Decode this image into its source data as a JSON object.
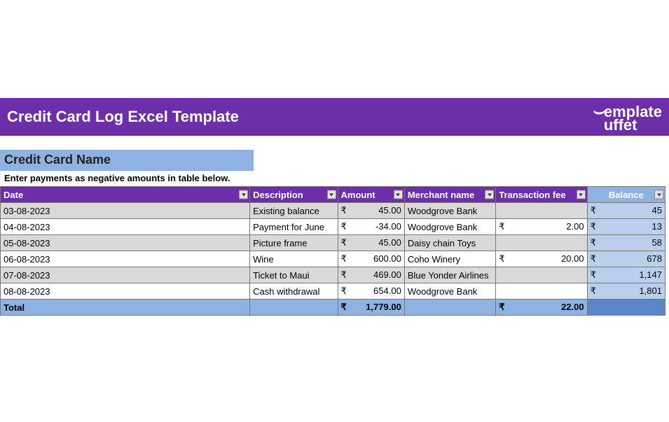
{
  "title": "Credit Card Log Excel Template",
  "logo_text_1": "emplate",
  "logo_text_2": "uffet",
  "card_name_label": "Credit Card Name",
  "instruction": "Enter payments as negative amounts in table below.",
  "currency_symbol": "₹",
  "columns": {
    "date": "Date",
    "description": "Description",
    "amount": "Amount",
    "merchant": "Merchant name",
    "fee": "Transaction fee",
    "balance": "Balance"
  },
  "rows": [
    {
      "date": "03-08-2023",
      "description": "Existing balance",
      "amount": "45.00",
      "merchant": "Woodgrove Bank",
      "fee": "",
      "balance": "45"
    },
    {
      "date": "04-08-2023",
      "description": "Payment for June",
      "amount": "-34.00",
      "merchant": "Woodgrove Bank",
      "fee": "2.00",
      "balance": "13"
    },
    {
      "date": "05-08-2023",
      "description": "Picture frame",
      "amount": "45.00",
      "merchant": "Daisy chain Toys",
      "fee": "",
      "balance": "58"
    },
    {
      "date": "06-08-2023",
      "description": "Wine",
      "amount": "600.00",
      "merchant": "Coho Winery",
      "fee": "20.00",
      "balance": "678"
    },
    {
      "date": "07-08-2023",
      "description": "Ticket to Maui",
      "amount": "469.00",
      "merchant": "Blue Yonder Airlines",
      "fee": "",
      "balance": "1,147"
    },
    {
      "date": "08-08-2023",
      "description": "Cash withdrawal",
      "amount": "654.00",
      "merchant": "Woodgrove Bank",
      "fee": "",
      "balance": "1,801"
    }
  ],
  "totals": {
    "label": "Total",
    "amount": "1,779.00",
    "fee": "22.00"
  },
  "col_widths": {
    "date": "355px",
    "description": "125px",
    "amount": "95px",
    "merchant": "130px",
    "fee": "130px",
    "balance": "111px"
  }
}
